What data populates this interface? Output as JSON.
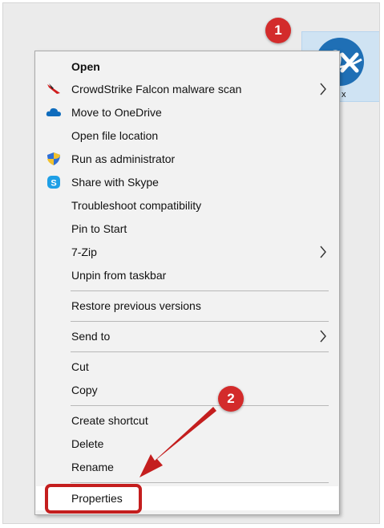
{
  "desktop_icon": {
    "label": "x"
  },
  "menu": {
    "items": [
      {
        "label": "Open",
        "icon": "",
        "submenu": false,
        "bold": true
      },
      {
        "label": "CrowdStrike Falcon malware scan",
        "icon": "falcon-icon",
        "submenu": true
      },
      {
        "label": "Move to OneDrive",
        "icon": "onedrive-cloud-icon",
        "submenu": false
      },
      {
        "label": "Open file location",
        "icon": "",
        "submenu": false
      },
      {
        "label": "Run as administrator",
        "icon": "uac-shield-icon",
        "submenu": false
      },
      {
        "label": "Share with Skype",
        "icon": "skype-icon",
        "submenu": false
      },
      {
        "label": "Troubleshoot compatibility",
        "icon": "",
        "submenu": false
      },
      {
        "label": "Pin to Start",
        "icon": "",
        "submenu": false
      },
      {
        "label": "7-Zip",
        "icon": "",
        "submenu": true
      },
      {
        "label": "Unpin from taskbar",
        "icon": "",
        "submenu": false
      },
      {
        "label": "Restore previous versions",
        "icon": "",
        "submenu": false
      },
      {
        "label": "Send to",
        "icon": "",
        "submenu": true
      },
      {
        "label": "Cut",
        "icon": "",
        "submenu": false
      },
      {
        "label": "Copy",
        "icon": "",
        "submenu": false
      },
      {
        "label": "Create shortcut",
        "icon": "",
        "submenu": false
      },
      {
        "label": "Delete",
        "icon": "",
        "submenu": false
      },
      {
        "label": "Rename",
        "icon": "",
        "submenu": false
      },
      {
        "label": "Properties",
        "icon": "",
        "submenu": false
      }
    ]
  },
  "annotations": {
    "step1": "1",
    "step2": "2"
  },
  "colors": {
    "annotation_red": "#d32b2b",
    "menu_background": "#f2f2f2",
    "hover_background": "#ffffff"
  }
}
